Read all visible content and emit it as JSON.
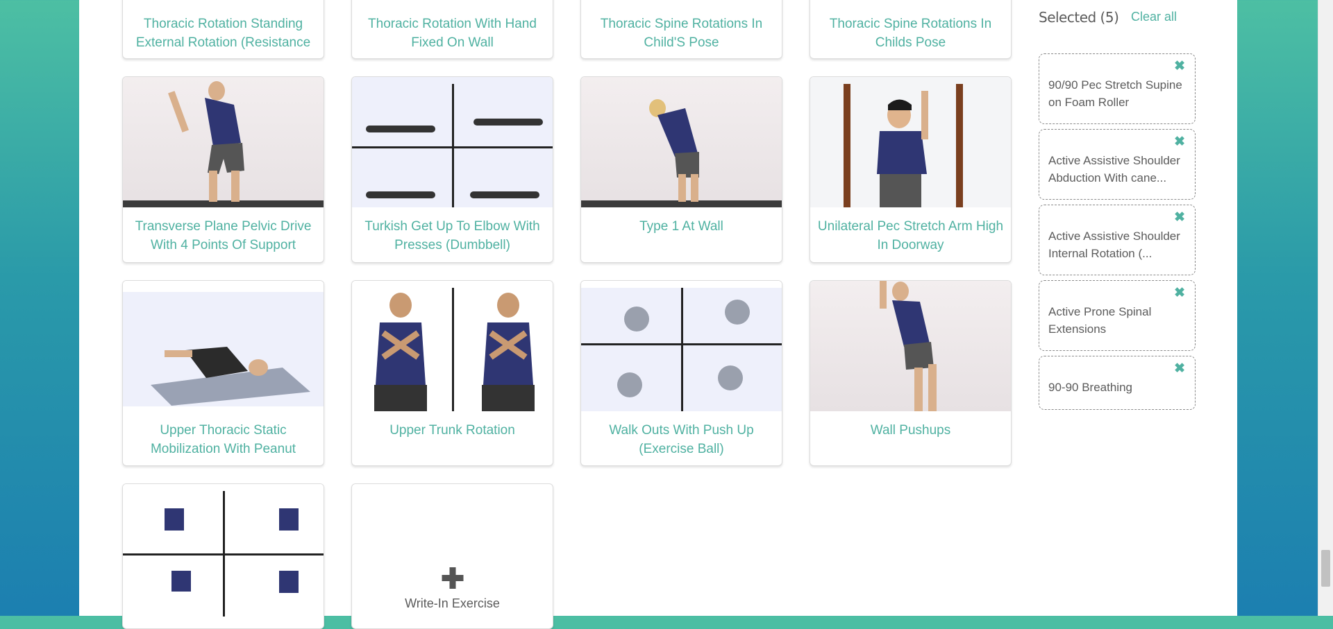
{
  "exercises_row0": [
    {
      "title": "Thoracic Rotation Standing External Rotation (Resistance Band)"
    },
    {
      "title": "Thoracic Rotation With Hand Fixed On Wall"
    },
    {
      "title": "Thoracic Spine Rotations In Child'S Pose"
    },
    {
      "title": "Thoracic Spine Rotations In Childs Pose"
    }
  ],
  "exercises_row1": [
    {
      "title": "Transverse Plane Pelvic Drive With 4 Points Of Support"
    },
    {
      "title": "Turkish Get Up To Elbow With Presses (Dumbbell)"
    },
    {
      "title": "Type 1 At Wall"
    },
    {
      "title": "Unilateral Pec Stretch Arm High In Doorway"
    }
  ],
  "exercises_row2": [
    {
      "title": "Upper Thoracic Static Mobilization With Peanut"
    },
    {
      "title": "Upper Trunk Rotation"
    },
    {
      "title": "Walk Outs With Push Up (Exercise Ball)"
    },
    {
      "title": "Wall Pushups"
    }
  ],
  "write_in": {
    "label": "Write-In Exercise"
  },
  "selected": {
    "heading": "Selected (5)",
    "clear_all": "Clear all",
    "items": [
      {
        "label": "90/90 Pec Stretch Supine on Foam Roller"
      },
      {
        "label": "Active Assistive Shoulder Abduction With cane..."
      },
      {
        "label": "Active Assistive Shoulder Internal Rotation (..."
      },
      {
        "label": "Active Prone Spinal Extensions"
      },
      {
        "label": "90-90 Breathing"
      }
    ]
  },
  "colors": {
    "accent": "#4fb1a1",
    "text": "#5b5b5b",
    "shirt": "#2f3673"
  }
}
